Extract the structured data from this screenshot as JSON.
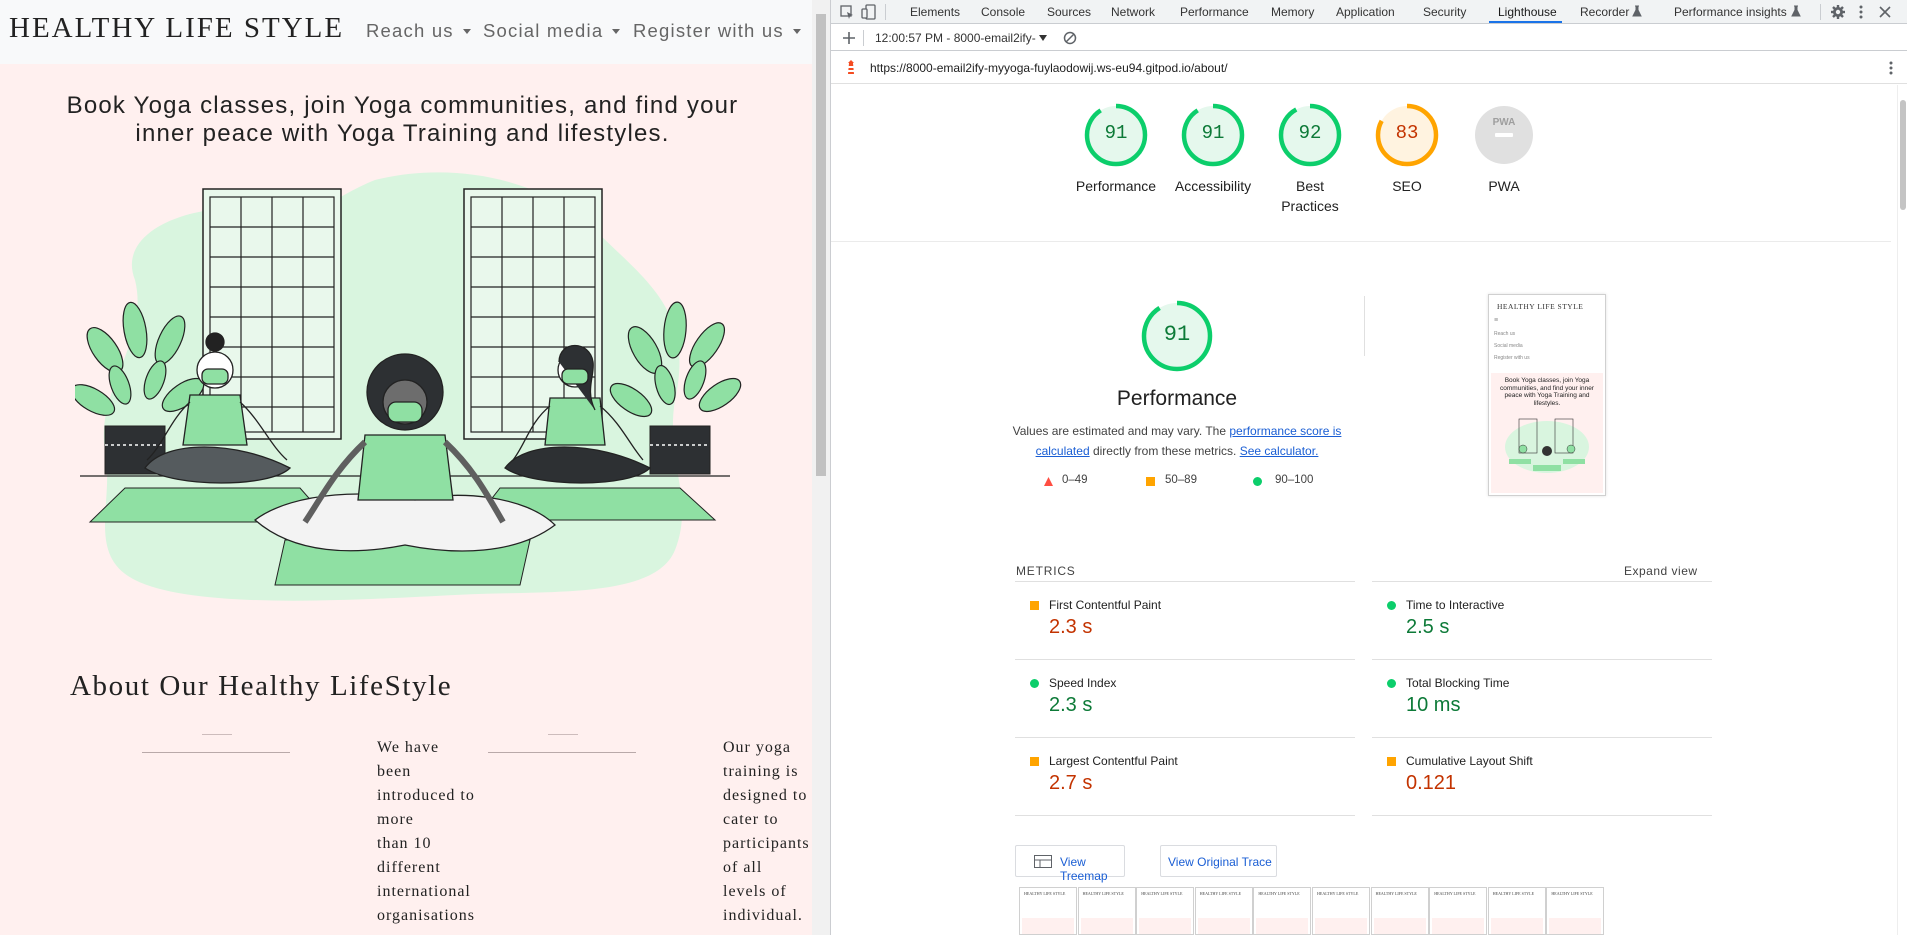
{
  "site": {
    "brand": "HEALTHY LIFE STYLE",
    "nav": [
      "Reach us",
      "Social media",
      "Register with us"
    ],
    "hero_text": "Book Yoga classes, join Yoga communities, and find your inner peace with Yoga Training and lifestyles.",
    "about_title": "About Our Healthy LifeStyle",
    "about_col1": [
      "We have",
      "been",
      "introduced to",
      "more",
      "than 10",
      "different",
      "international",
      "organisations"
    ],
    "about_col2": [
      "Our yoga",
      "training is",
      "designed to",
      "cater to",
      "participants",
      "of all",
      "levels of",
      "individual."
    ]
  },
  "devtools": {
    "tabs": [
      "Elements",
      "Console",
      "Sources",
      "Network",
      "Performance",
      "Memory",
      "Application",
      "Security",
      "Lighthouse",
      "Recorder",
      "Performance insights"
    ],
    "active_tab": "Lighthouse",
    "report_select": "12:00:57 PM - 8000-email2ify-",
    "url": "https://8000-email2ify-myyoga-fuylaodowij.ws-eu94.gitpod.io/about/"
  },
  "report": {
    "gauges": [
      {
        "label": "Performance",
        "score": 91,
        "status": "pass"
      },
      {
        "label": "Accessibility",
        "score": 91,
        "status": "pass"
      },
      {
        "label": "Best Practices",
        "score": 92,
        "status": "pass"
      },
      {
        "label": "SEO",
        "score": 83,
        "status": "average"
      },
      {
        "label": "PWA",
        "score": "",
        "status": "na"
      }
    ],
    "pwa_badge": "PWA",
    "perf_score": "91",
    "perf_title": "Performance",
    "perf_desc_1": "Values are estimated and may vary. The",
    "perf_desc_link1": "performance score is calculated",
    "perf_desc_2": "directly from these metrics.",
    "perf_desc_link2": "See calculator.",
    "legend": [
      "0–49",
      "50–89",
      "90–100"
    ],
    "screenshot": {
      "brand": "HEALTHY LIFE STYLE",
      "menu": [
        "Reach us",
        "Social media",
        "Register with us"
      ],
      "hero": "Book Yoga classes, join Yoga communities, and find your inner peace with Yoga Training and lifestyles."
    },
    "metrics_header": "METRICS",
    "expand_view": "Expand view",
    "metrics": [
      {
        "label": "First Contentful Paint",
        "value": "2.3 s",
        "status": "average"
      },
      {
        "label": "Time to Interactive",
        "value": "2.5 s",
        "status": "pass"
      },
      {
        "label": "Speed Index",
        "value": "2.3 s",
        "status": "pass"
      },
      {
        "label": "Total Blocking Time",
        "value": "10 ms",
        "status": "pass"
      },
      {
        "label": "Largest Contentful Paint",
        "value": "2.7 s",
        "status": "average"
      },
      {
        "label": "Cumulative Layout Shift",
        "value": "0.121",
        "status": "average"
      }
    ],
    "buttons": [
      "View Treemap",
      "View Original Trace"
    ],
    "filmstrip_count": 10
  },
  "colors": {
    "pass": "#0cce6b",
    "pass_text": "#0d7a38",
    "average": "#ffa400",
    "average_text": "#c33300",
    "fail": "#ff4e42",
    "site_bg": "#fff0ef",
    "link": "#1a5ed4",
    "illustration_green": "#8fe0a3"
  }
}
